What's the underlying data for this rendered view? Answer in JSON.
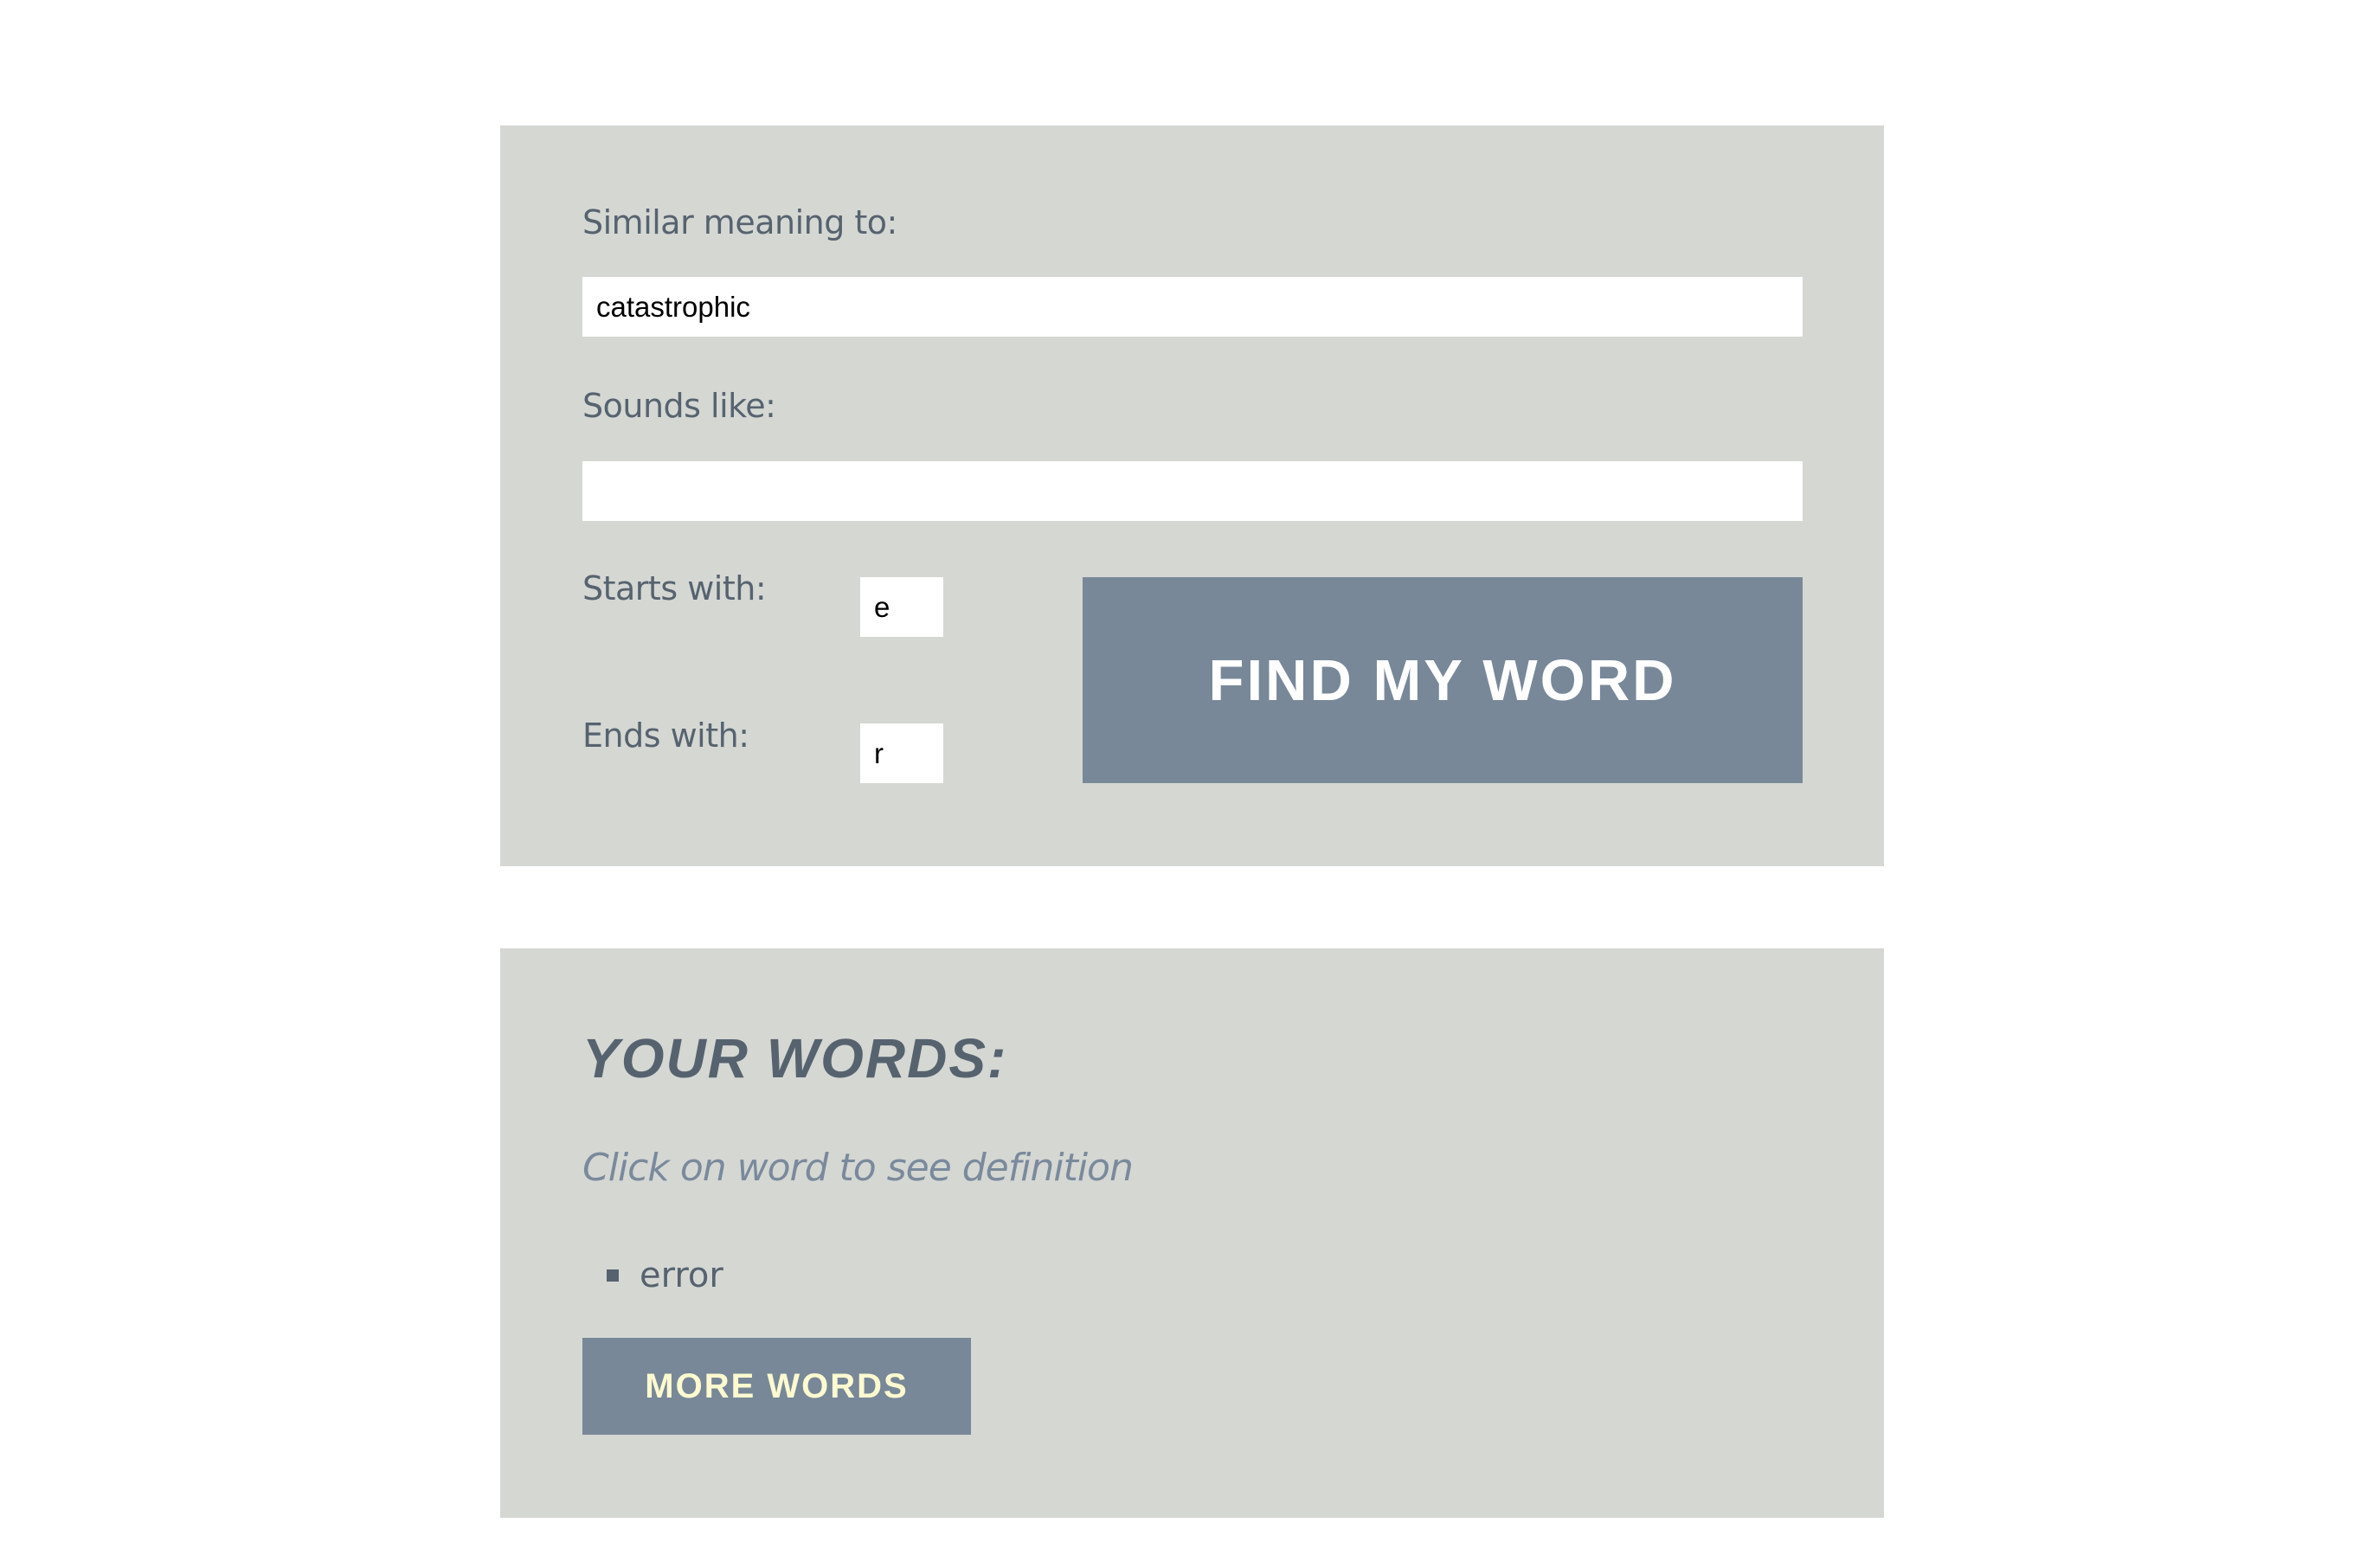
{
  "search_form": {
    "similar_meaning": {
      "label": "Similar meaning to:",
      "value": "catastrophic"
    },
    "sounds_like": {
      "label": "Sounds like:",
      "value": ""
    },
    "starts_with": {
      "label": "Starts with:",
      "value": "e"
    },
    "ends_with": {
      "label": "Ends with:",
      "value": "r"
    },
    "submit_label": "FIND MY WORD"
  },
  "results": {
    "title": "YOUR WORDS:",
    "hint": "Click on word to see definition",
    "words": [
      "error"
    ],
    "more_label": "MORE WORDS"
  },
  "colors": {
    "panel_background": "#d5d7d3",
    "button_background": "#788898",
    "label_text": "#56636f",
    "hint_text": "#7a8a9c",
    "more_button_text": "#fdfad0",
    "find_button_text": "#ffffff"
  },
  "icons": {
    "list_bullet": "square-bullet-icon"
  }
}
